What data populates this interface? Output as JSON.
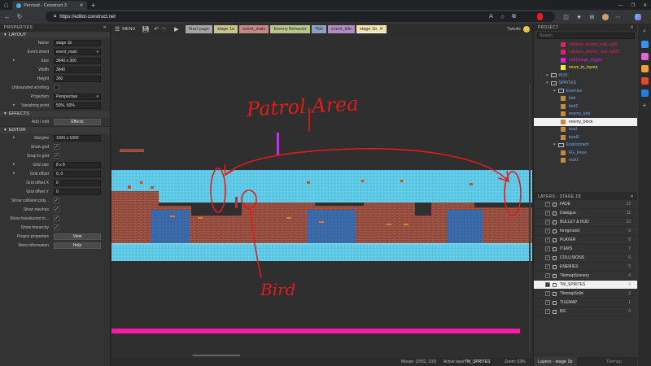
{
  "browser": {
    "tab_title": "Percival - Construct 3",
    "new_tab": "+",
    "url": "https://editor.construct.net",
    "window_controls": [
      "—",
      "❐",
      "✕"
    ]
  },
  "toolbar": {
    "menu_label": "MENU",
    "doc_tabs": [
      {
        "label": "Start page",
        "color": "#a5a5a5"
      },
      {
        "label": "stage 1a",
        "color": "#c7c58a"
      },
      {
        "label": "event_main",
        "color": "#c58787"
      },
      {
        "label": "Enemy Behavior",
        "color": "#b7c58a"
      },
      {
        "label": "Title",
        "color": "#8aa1c5"
      },
      {
        "label": "event_title",
        "color": "#b48ac5"
      },
      {
        "label": "stage 1b",
        "color": "#f2e2b2",
        "active": true
      }
    ],
    "user": "Twiedie"
  },
  "properties": {
    "panel_title": "PROPERTIES",
    "layout_section": "LAYOUT",
    "rows": [
      {
        "label": "Name",
        "value": "stage 1b",
        "kind": "text"
      },
      {
        "label": "Event sheet",
        "value": "event_main",
        "kind": "select"
      },
      {
        "label": "Size",
        "value": "3840 x 360",
        "kind": "text",
        "expand": true
      },
      {
        "label": "Width",
        "value": "3840",
        "kind": "text"
      },
      {
        "label": "Height",
        "value": "360",
        "kind": "text"
      },
      {
        "label": "Unbounded scrolling",
        "value": "",
        "kind": "check"
      },
      {
        "label": "Projection",
        "value": "Perspective",
        "kind": "select"
      },
      {
        "label": "Vanishing point",
        "value": "50%, 50%",
        "kind": "text",
        "expand": true
      }
    ],
    "effects_section": "EFFECTS",
    "effects_row": {
      "label": "Add / edit",
      "value": "Effects"
    },
    "editor_section": "EDITOR",
    "editor_rows": [
      {
        "label": "Margins",
        "value": "1000 x 1000",
        "kind": "text",
        "expand": true
      },
      {
        "label": "Show grid",
        "value": "✓",
        "kind": "check"
      },
      {
        "label": "Snap to grid",
        "value": "✓",
        "kind": "check"
      },
      {
        "label": "Grid size",
        "value": "8 x 8",
        "kind": "text",
        "expand": true
      },
      {
        "label": "Grid offset",
        "value": "0, 0",
        "kind": "text",
        "expand": true
      },
      {
        "label": "Grid offset X",
        "value": "0",
        "kind": "text"
      },
      {
        "label": "Grid offset Y",
        "value": "0",
        "kind": "text"
      },
      {
        "label": "Show collision poly...",
        "value": "✓",
        "kind": "check"
      },
      {
        "label": "Show meshes",
        "value": "✓",
        "kind": "check"
      },
      {
        "label": "Show translucent in...",
        "value": "✓",
        "kind": "check"
      },
      {
        "label": "Show hierarchy",
        "value": "✓",
        "kind": "check"
      },
      {
        "label": "Project properties",
        "value": "View",
        "kind": "button"
      },
      {
        "label": "More information",
        "value": "Help",
        "kind": "button"
      }
    ]
  },
  "project": {
    "panel_title": "PROJECT",
    "search_placeholder": "Search",
    "items": [
      {
        "label": "collision_enemy_wall_right",
        "color": "#e0206a",
        "depth": 3
      },
      {
        "label": "collision_enemy_wall_right2",
        "color": "#e0206a",
        "depth": 3
      },
      {
        "label": "end1Stage_trigger",
        "color": "#e020d0",
        "depth": 3
      },
      {
        "label": "move_to_layout",
        "color": "#f0f020",
        "depth": 3
      },
      {
        "label": "HUD",
        "color": "#6aa8ff",
        "depth": 1,
        "folder": true
      },
      {
        "label": "SPRITES",
        "color": "#6aa8ff",
        "depth": 1,
        "folder": true
      },
      {
        "label": "Enemies",
        "color": "#6aa8ff",
        "depth": 2,
        "folder": true
      },
      {
        "label": "bird",
        "color": "#c88a3a",
        "depth": 3
      },
      {
        "label": "bird2",
        "color": "#c88a3a",
        "depth": 3
      },
      {
        "label": "enemy_bird",
        "color": "#c88a3a",
        "depth": 3
      },
      {
        "label": "enemy_block",
        "color": "#c88a3a",
        "depth": 3,
        "selected": true
      },
      {
        "label": "toad",
        "color": "#c88a3a",
        "depth": 3
      },
      {
        "label": "toad2",
        "color": "#c88a3a",
        "depth": 3
      },
      {
        "label": "Environment",
        "color": "#6aa8ff",
        "depth": 2,
        "folder": true
      },
      {
        "label": "FG_fence",
        "color": "#c88a3a",
        "depth": 3
      },
      {
        "label": "rock1",
        "color": "#c88a3a",
        "depth": 3
      }
    ]
  },
  "layers": {
    "panel_title": "LAYERS - STAGE 1B",
    "items": [
      {
        "name": "FADE",
        "num": "12"
      },
      {
        "name": "Dialogue",
        "num": "11"
      },
      {
        "name": "BULLET & HUD",
        "num": "10"
      },
      {
        "name": "foreground",
        "num": "9"
      },
      {
        "name": "PLAYER",
        "num": "8"
      },
      {
        "name": "ITEMS",
        "num": "7"
      },
      {
        "name": "COLLISIONS",
        "num": "6"
      },
      {
        "name": "ENEMIES",
        "num": "5"
      },
      {
        "name": "TilemapScenery",
        "num": "4"
      },
      {
        "name": "TM_SPRITES",
        "num": "3",
        "selected": true
      },
      {
        "name": "TilemapSolid",
        "num": "2"
      },
      {
        "name": "TILEMAP",
        "num": "1"
      },
      {
        "name": "BG",
        "num": "0"
      }
    ],
    "bottom_tabs": [
      "Layers - stage 1b",
      "Tilemap"
    ]
  },
  "status": {
    "mouse": "Mouse: (1552, 103)",
    "active_layer_label": "Active layer:",
    "active_layer": "TM_SPRITES",
    "zoom": "Zoom: 53%"
  },
  "annotations": {
    "patrol": "Patrol Area",
    "bird": "Bird"
  },
  "colors": {
    "accent_magenta": "#ff1aa8",
    "annotation_red": "#e21b1b",
    "sky": "#5ec8e6",
    "brick": "#a75a4a",
    "water": "#3b6aa8"
  }
}
